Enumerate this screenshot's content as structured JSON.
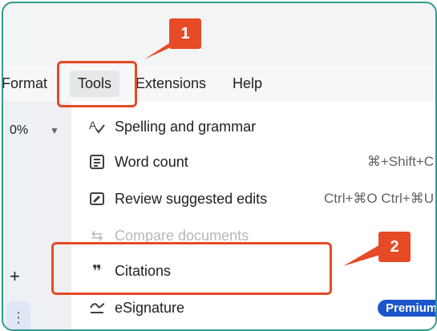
{
  "menubar": {
    "items": [
      "Format",
      "Tools",
      "Extensions",
      "Help"
    ]
  },
  "toolbar": {
    "zoom_value": "0%",
    "add_label": "+",
    "more_label": "⋮"
  },
  "tools_menu": {
    "items": [
      {
        "icon": "spellcheck-icon",
        "label": "Spelling and grammar",
        "shortcut": "",
        "disabled": false
      },
      {
        "icon": "word-count-icon",
        "label": "Word count",
        "shortcut": "⌘+Shift+C",
        "disabled": false
      },
      {
        "icon": "review-edits-icon",
        "label": "Review suggested edits",
        "shortcut": "Ctrl+⌘O Ctrl+⌘U",
        "disabled": false
      },
      {
        "icon": "compare-icon",
        "label": "Compare documents",
        "shortcut": "",
        "disabled": true
      },
      {
        "icon": "quote-icon",
        "label": "Citations",
        "shortcut": "",
        "disabled": false
      },
      {
        "icon": "signature-icon",
        "label": "eSignature",
        "badge": "Premium",
        "disabled": false
      }
    ]
  },
  "annotations": {
    "callout_1": "1",
    "callout_2": "2",
    "accent_color": "#e64a26"
  }
}
